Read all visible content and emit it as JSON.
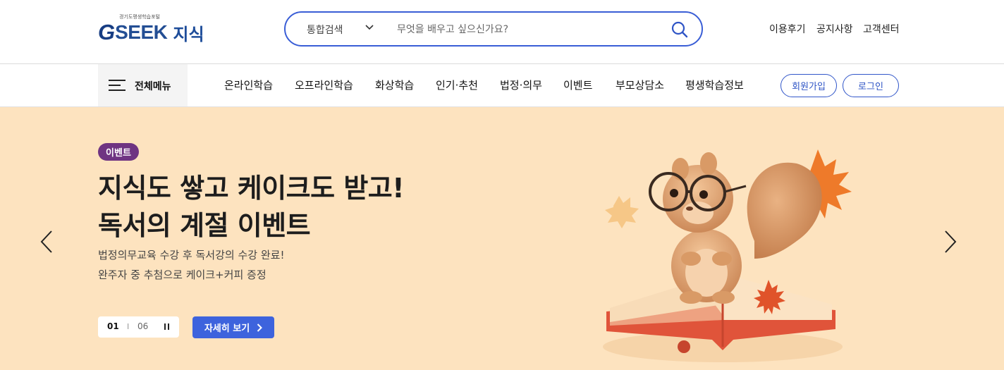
{
  "header": {
    "logo": {
      "sub": "경기도평생학습포털",
      "brand_g": "G",
      "brand_text": "SEEK",
      "brand_kr": "지식"
    },
    "search": {
      "category": "통합검색",
      "placeholder": "무엇을 배우고 싶으신가요?",
      "value": ""
    },
    "utility_links": [
      "이용후기",
      "공지사항",
      "고객센터"
    ]
  },
  "nav": {
    "all_menu_label": "전체메뉴",
    "items": [
      "온라인학습",
      "오프라인학습",
      "화상학습",
      "인기·추천",
      "법정·의무",
      "이벤트",
      "부모상담소",
      "평생학습정보"
    ],
    "signup_label": "회원가입",
    "login_label": "로그인"
  },
  "hero": {
    "badge": "이벤트",
    "title_line1": "지식도 쌓고 케이크도 받고!",
    "title_line2": "독서의 계절 이벤트",
    "desc_line1": "법정의무교육 수강 후 독서강의 수강 완료!",
    "desc_line2": "완주자 중 추첨으로 케이크+커피 증정",
    "pager": {
      "current": "01",
      "separator": "I",
      "total": "06"
    },
    "detail_label": "자세히 보기",
    "background_color": "#fde3bf"
  },
  "colors": {
    "accent": "#3d63dd",
    "badge": "#6f3482",
    "brand": "#1e4d9a"
  }
}
